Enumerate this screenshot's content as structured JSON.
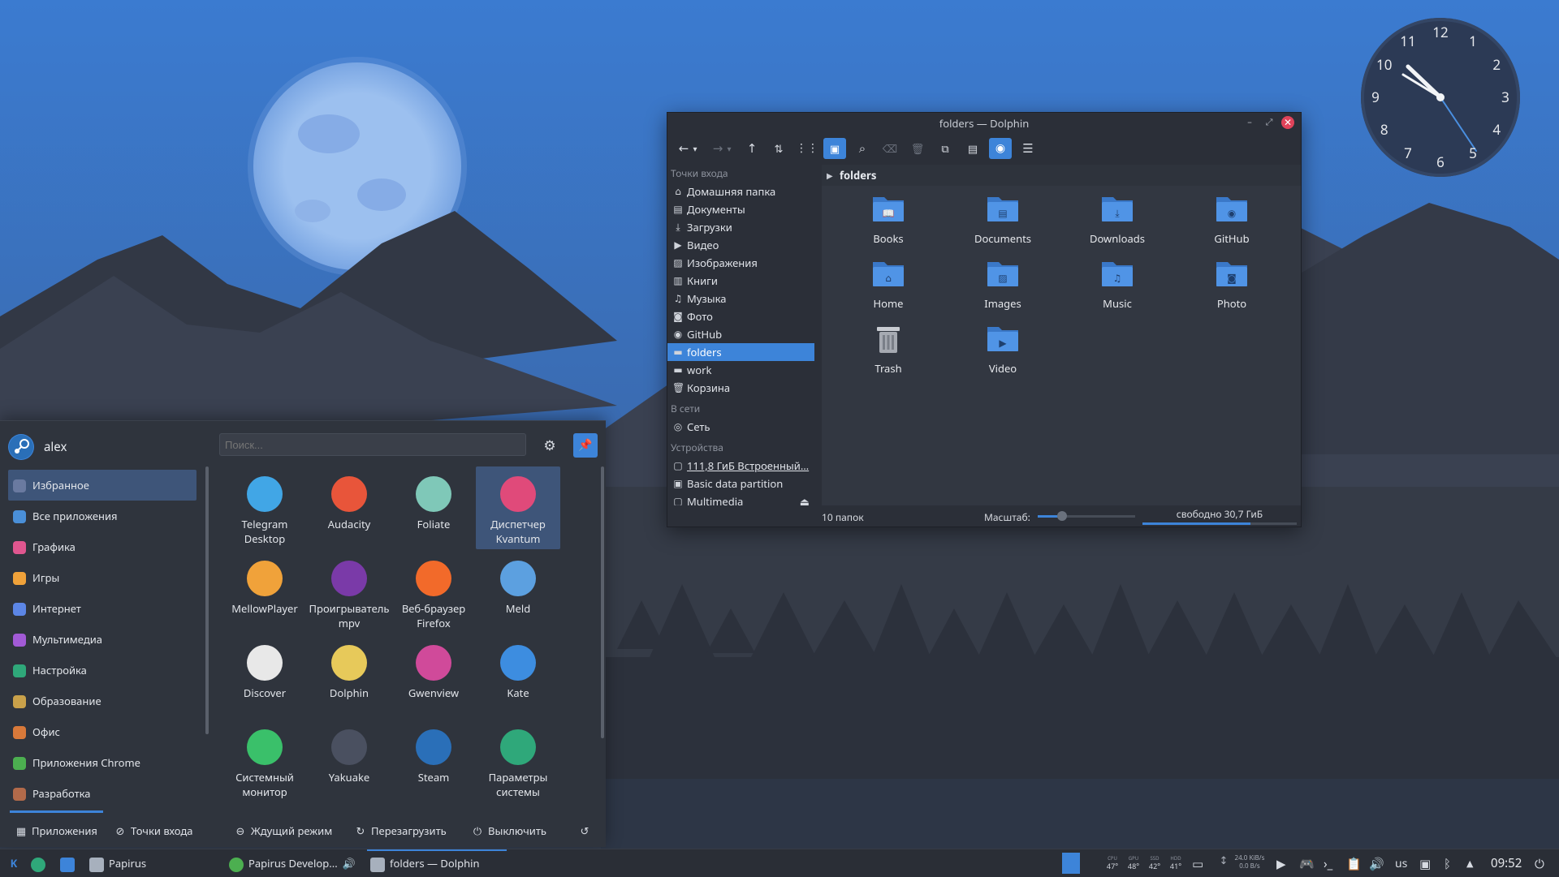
{
  "dolphin": {
    "title": "folders — Dolphin",
    "places": {
      "sections": [
        {
          "title": "Точки входа",
          "items": [
            {
              "label": "Домашняя папка",
              "icon": "home-icon"
            },
            {
              "label": "Документы",
              "icon": "document-icon"
            },
            {
              "label": "Загрузки",
              "icon": "download-icon"
            },
            {
              "label": "Видео",
              "icon": "video-icon"
            },
            {
              "label": "Изображения",
              "icon": "image-icon"
            },
            {
              "label": "Книги",
              "icon": "book-icon"
            },
            {
              "label": "Музыка",
              "icon": "music-icon"
            },
            {
              "label": "Фото",
              "icon": "camera-icon"
            },
            {
              "label": "GitHub",
              "icon": "github-icon"
            },
            {
              "label": "folders",
              "icon": "folder-icon",
              "selected": true
            },
            {
              "label": "work",
              "icon": "folder-icon"
            },
            {
              "label": "Корзина",
              "icon": "trash-icon"
            }
          ]
        },
        {
          "title": "В сети",
          "items": [
            {
              "label": "Сеть",
              "icon": "network-icon"
            }
          ]
        },
        {
          "title": "Устройства",
          "items": [
            {
              "label": "111,8 ГиБ Встроенный…",
              "icon": "drive-icon"
            },
            {
              "label": "Basic data partition",
              "icon": "partition-icon"
            },
            {
              "label": "Multimedia",
              "icon": "drive-icon"
            }
          ]
        }
      ]
    },
    "breadcrumb": "folders",
    "files": [
      {
        "name": "Books",
        "glyph": "book"
      },
      {
        "name": "Documents",
        "glyph": "doc"
      },
      {
        "name": "Downloads",
        "glyph": "down"
      },
      {
        "name": "GitHub",
        "glyph": "gh"
      },
      {
        "name": "Home",
        "glyph": "home"
      },
      {
        "name": "Images",
        "glyph": "img"
      },
      {
        "name": "Music",
        "glyph": "music"
      },
      {
        "name": "Photo",
        "glyph": "cam"
      },
      {
        "name": "Trash",
        "glyph": "trash"
      },
      {
        "name": "Video",
        "glyph": "video"
      }
    ],
    "status": {
      "count": "10 папок",
      "zoom_label": "Масштаб:",
      "free": "свободно 30,7 ГиБ",
      "zoom_level": 0.25,
      "used_fraction": 0.7
    }
  },
  "launcher": {
    "user": "alex",
    "search_placeholder": "Поиск...",
    "categories": [
      {
        "label": "Избранное",
        "color": "#6a7aa0",
        "selected": true
      },
      {
        "label": "Все приложения",
        "color": "#4a8fd8"
      },
      {
        "label": "Графика",
        "color": "#e0568f"
      },
      {
        "label": "Игры",
        "color": "#f0a23a"
      },
      {
        "label": "Интернет",
        "color": "#5c86e6"
      },
      {
        "label": "Мультимедиа",
        "color": "#a25ad6"
      },
      {
        "label": "Настройка",
        "color": "#2fa87a"
      },
      {
        "label": "Образование",
        "color": "#c9a14a"
      },
      {
        "label": "Офис",
        "color": "#d8793a"
      },
      {
        "label": "Приложения Chrome",
        "color": "#4caf50"
      },
      {
        "label": "Разработка",
        "color": "#b26a4a"
      }
    ],
    "apps": [
      {
        "label": "Telegram Desktop",
        "color": "#41a6e6",
        "icon": "telegram-icon"
      },
      {
        "label": "Audacity",
        "color": "#e8553a",
        "icon": "audacity-icon"
      },
      {
        "label": "Foliate",
        "color": "#7fc8b8",
        "icon": "foliate-icon"
      },
      {
        "label": "Диспетчер Kvantum",
        "color": "#e04a7a",
        "icon": "kvantum-icon",
        "selected": true
      },
      {
        "label": "MellowPlayer",
        "color": "#f0a23a",
        "icon": "mellowplayer-icon"
      },
      {
        "label": "Проигрыватель mpv",
        "color": "#7a3aa8",
        "icon": "mpv-icon"
      },
      {
        "label": "Веб-браузер Firefox",
        "color": "#f26a2a",
        "icon": "firefox-icon"
      },
      {
        "label": "Meld",
        "color": "#5ca0e0",
        "icon": "meld-icon"
      },
      {
        "label": "Discover",
        "color": "#e8e8e8",
        "icon": "discover-icon"
      },
      {
        "label": "Dolphin",
        "color": "#e7c95a",
        "icon": "dolphin-icon"
      },
      {
        "label": "Gwenview",
        "color": "#d04a9a",
        "icon": "gwenview-icon"
      },
      {
        "label": "Kate",
        "color": "#3d8de0",
        "icon": "kate-icon"
      },
      {
        "label": "Системный монитор",
        "color": "#3ac06a",
        "icon": "sysmon-icon"
      },
      {
        "label": "Yakuake",
        "color": "#4a5060",
        "icon": "yakuake-icon"
      },
      {
        "label": "Steam",
        "color": "#2a6fb8",
        "icon": "steam-icon"
      },
      {
        "label": "Параметры системы",
        "color": "#2fa87a",
        "icon": "settings-icon"
      }
    ],
    "footer": {
      "apps": "Приложения",
      "places": "Точки входа",
      "sleep": "Ждущий режим",
      "restart": "Перезагрузить",
      "shutdown": "Выключить"
    }
  },
  "taskbar": {
    "tasks": [
      {
        "label": "Papirus"
      },
      {
        "label": "Papirus Develop..."
      },
      {
        "label": "folders — Dolphin",
        "active": true
      }
    ],
    "sensors": [
      {
        "label": "CPU",
        "value": "47°"
      },
      {
        "label": "GPU",
        "value": "48°"
      },
      {
        "label": "SSD",
        "value": "42°"
      },
      {
        "label": "HDD",
        "value": "41°"
      }
    ],
    "net": {
      "up": "24.0 KiB/s",
      "down": "0.0 B/s"
    },
    "keyboard": "us",
    "time": "09:52"
  },
  "clock_face": {
    "numbers": [
      "12",
      "1",
      "2",
      "3",
      "4",
      "5",
      "6",
      "7",
      "8",
      "9",
      "10",
      "11"
    ]
  },
  "colors": {
    "accent": "#3d84d9",
    "panel": "#2b2f38",
    "wallpaper_sky": "#3d7bcb"
  }
}
